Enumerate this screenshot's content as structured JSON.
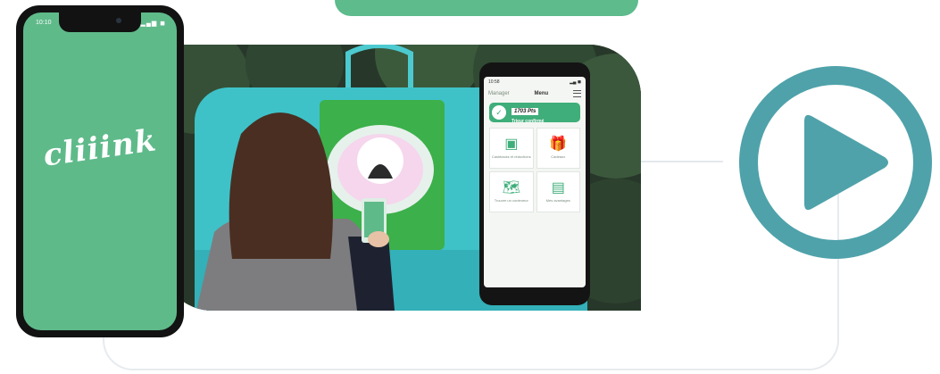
{
  "left_phone": {
    "time": "10:10",
    "status_icons": "▂▄▆ ◼",
    "logo": "cliiink"
  },
  "right_phone": {
    "time": "10:58",
    "status_icons": "▂▄ ◼",
    "nav_left": "Manager",
    "menu_title": "Menu",
    "points": "1703 Pts",
    "status": "Trieur confirmé",
    "tiles": [
      {
        "icon": "camera-icon",
        "glyph": "▣",
        "label": "Cashbacks et réductions"
      },
      {
        "icon": "gift-icon",
        "glyph": "🎁",
        "label": "Cadeaux"
      },
      {
        "icon": "map-icon",
        "glyph": "🗺",
        "label": "Trouver un conteneur"
      },
      {
        "icon": "card-icon",
        "glyph": "▤",
        "label": "Mes avantages"
      }
    ]
  },
  "play_button": {
    "icon": "play-icon",
    "color": "#4fa2aa"
  },
  "colors": {
    "brand_green": "#5fba8a",
    "accent_teal": "#4fa2aa"
  }
}
